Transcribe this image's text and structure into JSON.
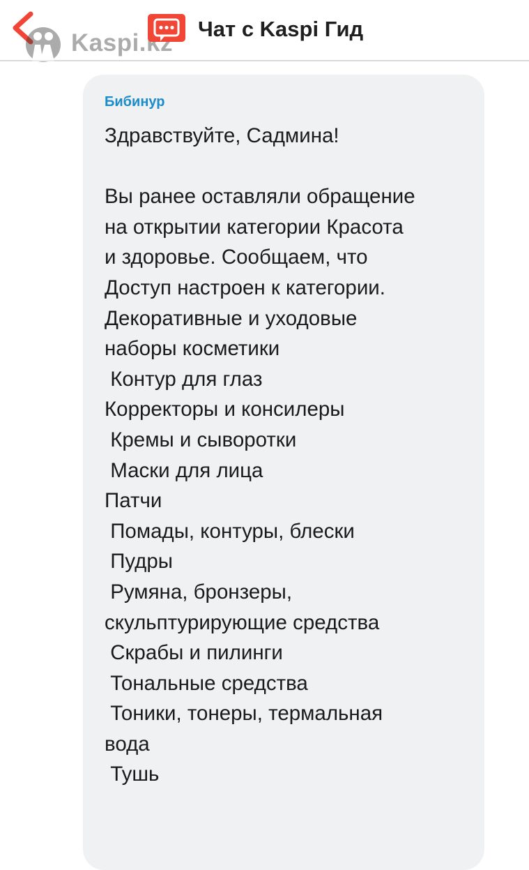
{
  "header": {
    "back_icon": "chevron-left-icon",
    "watermark_text": "Kaspi.kz",
    "chat_icon": "chat-bubble-icon",
    "title": "Чат с Kaspi Гид",
    "accent_color": "#f14635"
  },
  "message": {
    "sender": "Бибинур",
    "text": "Здравствуйте, Садмина!\n\nВы ранее оставляли обращение\nна открытии категории Красота\nи здоровье. Сообщаем, что\nДоступ настроен к категории.\nДекоративные и уходовые\nнаборы косметики\n Контур для глаз\nКорректоры и консилеры\n Кремы и сыворотки\n Маски для лица\nПатчи\n Помады, контуры, блески\n Пудры\n Румяна, бронзеры,\nскульптурирующие средства\n Скрабы и пилинги\n Тональные средства\n Тоники, тонеры, термальная\nвода\n Тушь",
    "sender_color": "#1b8bc9",
    "bubble_color": "#eff1f3"
  }
}
